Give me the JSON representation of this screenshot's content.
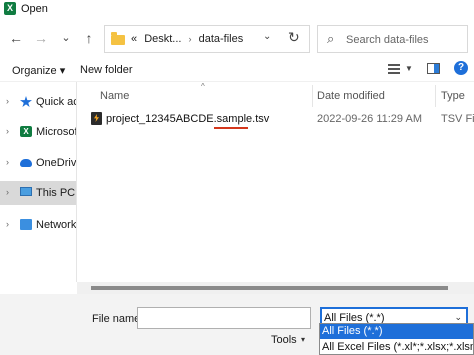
{
  "window": {
    "title": "Open",
    "app_icon": "excel-icon"
  },
  "nav": {
    "back": "←",
    "forward": "→",
    "recent": "⌄",
    "up": "↑",
    "address": {
      "root_marker": "«",
      "crumbs": [
        "Deskt...",
        "data-files"
      ],
      "separator": "›",
      "dropdown": "⌄",
      "refresh": "↻"
    },
    "search": {
      "placeholder": "Search data-files"
    }
  },
  "toolbar": {
    "organize": "Organize ▾",
    "new_folder": "New folder"
  },
  "sidebar": {
    "items": [
      {
        "label": "Quick acc",
        "icon": "star-icon"
      },
      {
        "label": "Microsoft",
        "icon": "excel-icon"
      },
      {
        "label": "OneDrive",
        "icon": "cloud-icon"
      },
      {
        "label": "This PC",
        "icon": "computer-icon",
        "selected": true
      },
      {
        "label": "Network",
        "icon": "network-icon"
      }
    ]
  },
  "file_list": {
    "columns": [
      "Name",
      "Date modified",
      "Type"
    ],
    "sort_indicator": "^",
    "rows": [
      {
        "name": "project_12345ABCDE.sample.tsv",
        "date": "2022-09-26 11:29 AM",
        "type": "TSV File"
      }
    ]
  },
  "bottom": {
    "file_name_label": "File name:",
    "file_name_value": "",
    "filter_selected": "All Files (*.*)",
    "filter_arrow": "⌄",
    "tools_label": "Tools",
    "tools_arrow": "▾",
    "filter_options": [
      "All Files (*.*)",
      "All Excel Files (*.xl*;*.xlsx;*.xlsm;*.xlsb;*"
    ]
  },
  "colors": {
    "accent": "#1e6fd9",
    "excel": "#107c41",
    "highlight": "#d4371c"
  }
}
